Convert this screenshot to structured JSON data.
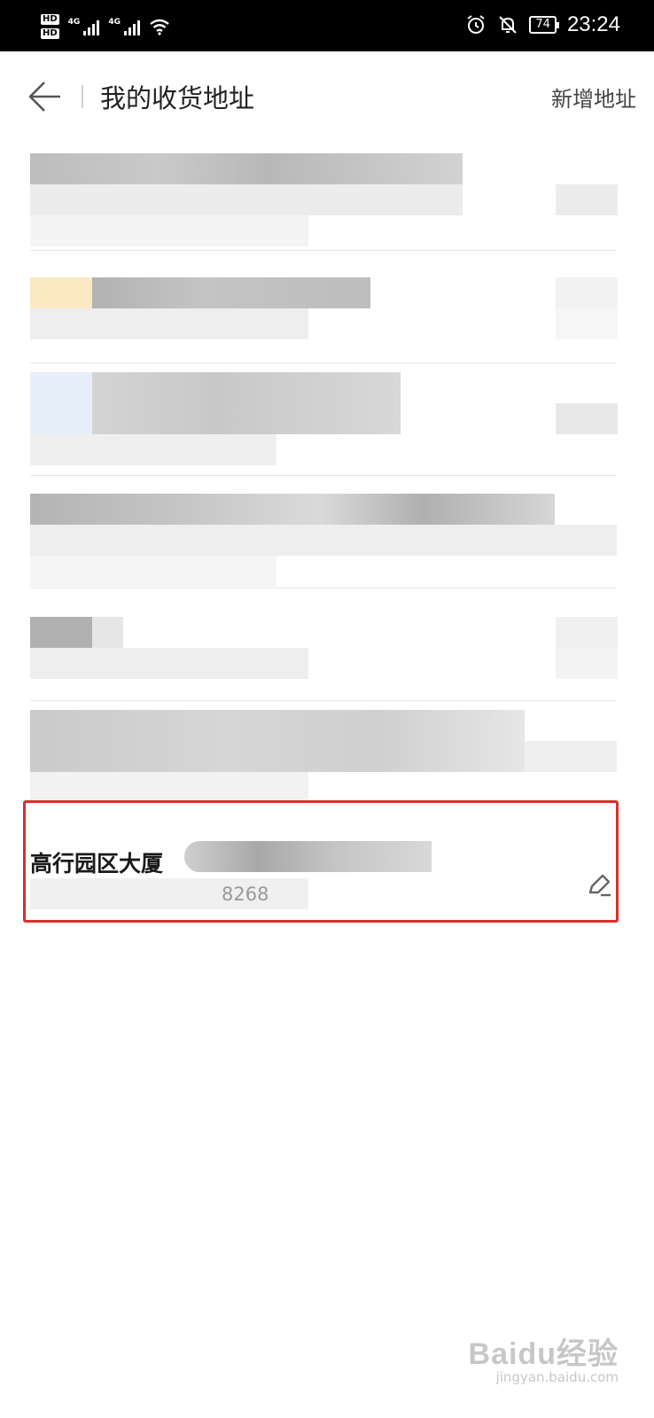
{
  "status_bar": {
    "hd1": "HD",
    "hd2": "HD",
    "net1": "4G",
    "net2": "4G",
    "battery": "74",
    "time": "23:24",
    "icons": [
      "wifi-icon",
      "alarm-icon",
      "mute-icon"
    ]
  },
  "header": {
    "title": "我的收货地址",
    "add_label": "新增地址"
  },
  "addresses": [
    {
      "name": "",
      "phone": "",
      "blurred": true
    },
    {
      "name": "",
      "phone": "",
      "blurred": true
    },
    {
      "name": "",
      "phone": "",
      "blurred": true
    },
    {
      "name": "",
      "phone": "",
      "blurred": true
    },
    {
      "name": "",
      "phone": "",
      "blurred": true
    },
    {
      "name": "",
      "phone": "",
      "blurred": true
    },
    {
      "name": "高行园区大厦",
      "phone": "8268",
      "blurred": false
    }
  ],
  "highlight_color": "#d9302c",
  "watermark": {
    "main": "Baidu经验",
    "sub": "jingyan.baidu.com"
  }
}
